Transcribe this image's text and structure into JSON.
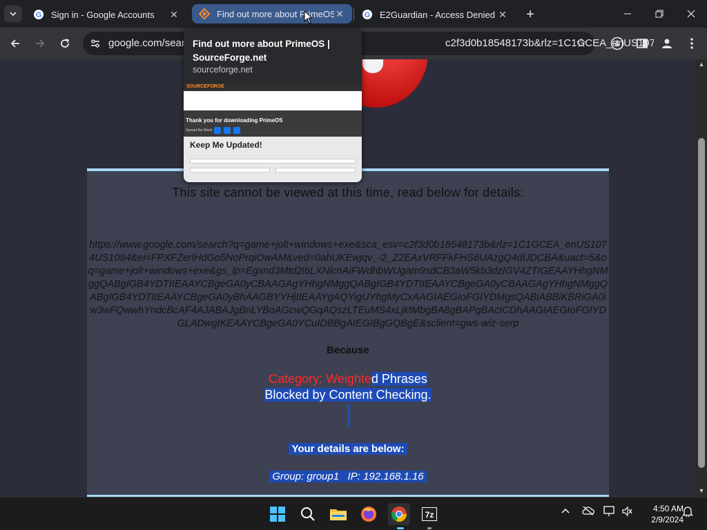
{
  "tabs": [
    {
      "title": "Sign in - Google Accounts",
      "favicon": "google-icon"
    },
    {
      "title": "Find out more about PrimeOS",
      "favicon": "sourceforge-icon",
      "active_hover": true
    },
    {
      "title": "E2Guardian - Access Denied",
      "favicon": "google-icon",
      "active": true
    }
  ],
  "omnibox": {
    "text_left": "google.com/searc",
    "text_right": "c2f3d0b18548173b&rlz=1C1GCEA_enUS1074U..."
  },
  "hovercard": {
    "title": "Find out more about PrimeOS | SourceForge.net",
    "domain": "sourceforge.net",
    "preview": {
      "logo": "SOURCEFORGE",
      "thanks": "Thank you for downloading PrimeOS",
      "spread": "Spread the Word:",
      "keep": "Keep Me Updated!"
    }
  },
  "page": {
    "headline": "This site cannot be viewed at this time, read below for details:",
    "url": "https://www.google.com/search?q=game+jolt+windows+exe&sca_esv=c2f3d0b18548173b&rlz=1C1GCEA_enUS1074US1094&ei=FPXFZerlHdGo5NoPrqiOwAM&ved=0ahUKEwjqv_-2_Z2EAxVRFFkFHS6UAzgQ4dUDCBA&uact=5&oq=game+jolt+windows+exe&gs_lp=Egxnd3Mtd2l6LXNlcnAiFWdhbWUgam9sdCB3aW5kb3dzIGV4ZTIGEAAYHhgNMggQABgIGB4YDTIIEAAYCBgeGA0yCBAAGAgYHhgNMggQABgIGB4YDTIIEAAYCBgeGA0yCBAAGAgYHhgNMggQABgIGB4YDTIIEAAYCBgeGA0yBhAAGBYYHjIIEAAYgAQYigUYhgMyCxAAGIAEGIoFGIYDMgsQABiABBiKBRiGA0iw3wFQwwhYndcBcAF4AJABAJgBnLYBoAGcwQGqAQszLTEuMS4xLjktMbgBA8gBAPgBAcICDhAAGIAEGIoFGIYDGLADwgIKEAAYCBgeGA0YCuIDBBgAIEGIBgGQBgE&sclient=gws-wiz-serp",
    "because": "Because",
    "category_prefix": "Category: Weighte",
    "category_suffix": "d Phrases",
    "blocked": "Blocked by Content Checking.",
    "details": "Your details are below:",
    "group": "Group: group1   IP: 192.168.1.16"
  },
  "taskbar": {
    "time": "4:50 AM",
    "date": "2/9/2024"
  },
  "colors": {
    "panel": "#3d4152",
    "panel_border": "#a9d6f5",
    "selection": "#1e4bb5",
    "category_red": "#ff2a2a"
  }
}
